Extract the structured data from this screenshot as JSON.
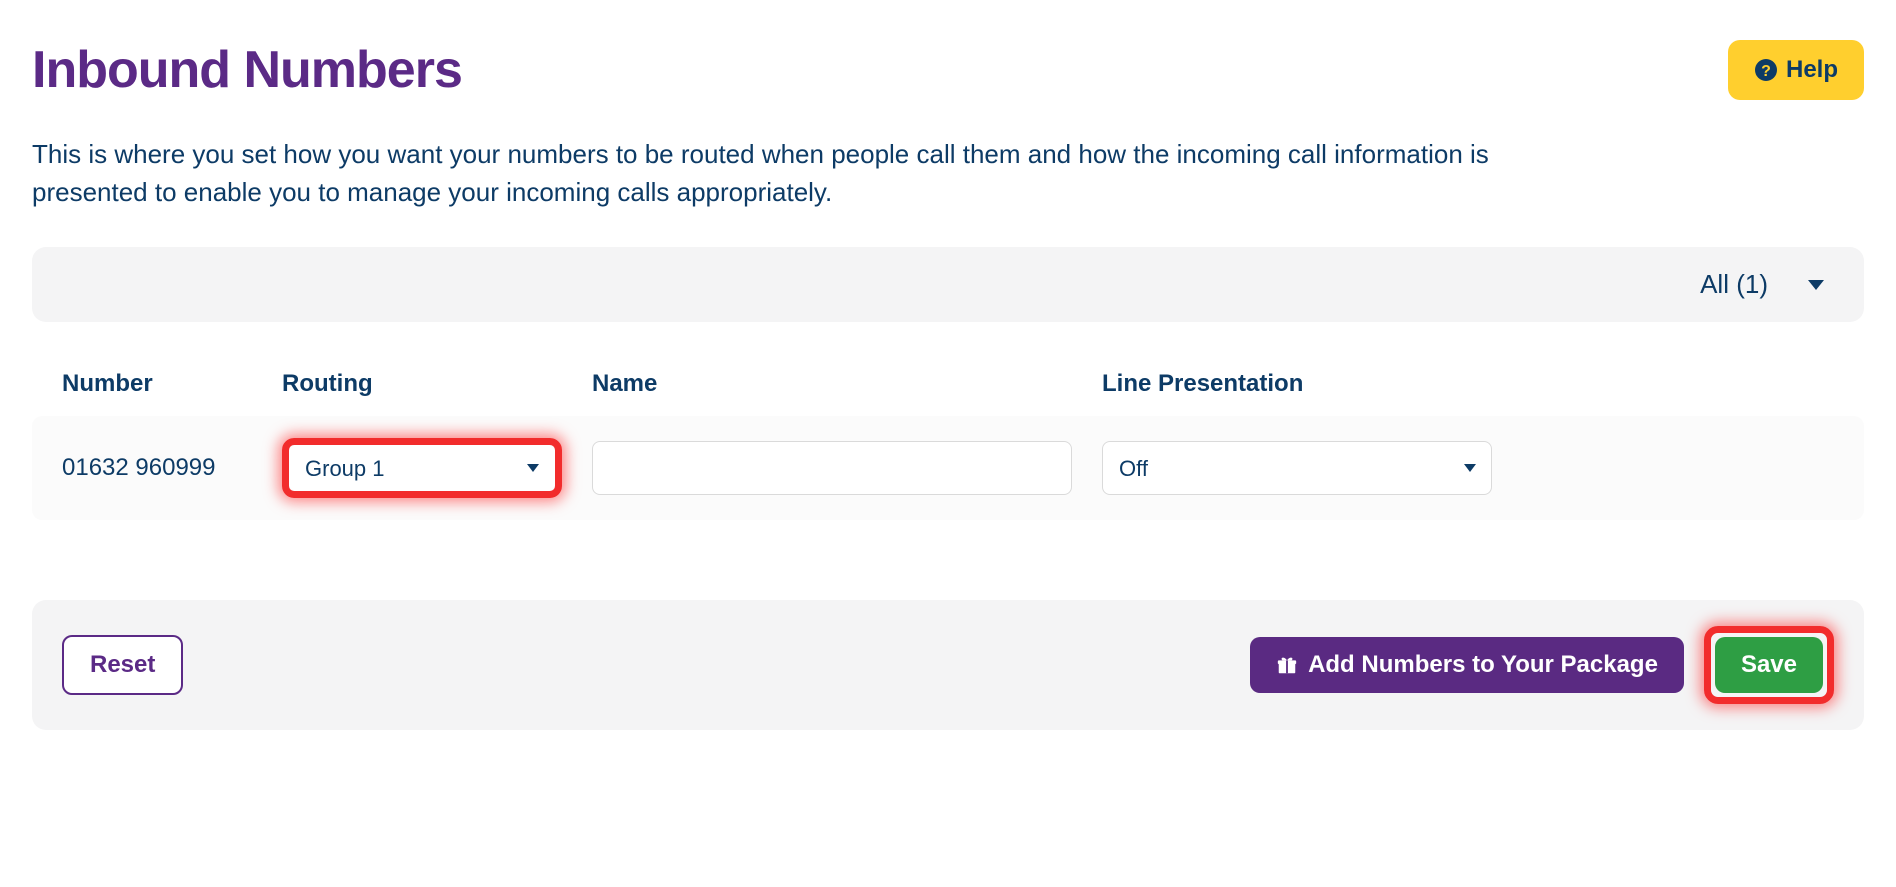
{
  "header": {
    "title": "Inbound Numbers",
    "help_label": "Help"
  },
  "intro": "This is where you set how you want your numbers to be routed when people call them and how the incoming call information is presented to enable you to manage your incoming calls appropriately.",
  "filter": {
    "selected": "All (1)"
  },
  "table": {
    "columns": {
      "number": "Number",
      "routing": "Routing",
      "name": "Name",
      "line_presentation": "Line Presentation"
    },
    "rows": [
      {
        "number": "01632 960999",
        "routing_value": "Group 1",
        "name_value": "",
        "line_presentation_value": "Off"
      }
    ]
  },
  "actions": {
    "reset": "Reset",
    "add_numbers": "Add Numbers to Your Package",
    "save": "Save"
  }
}
